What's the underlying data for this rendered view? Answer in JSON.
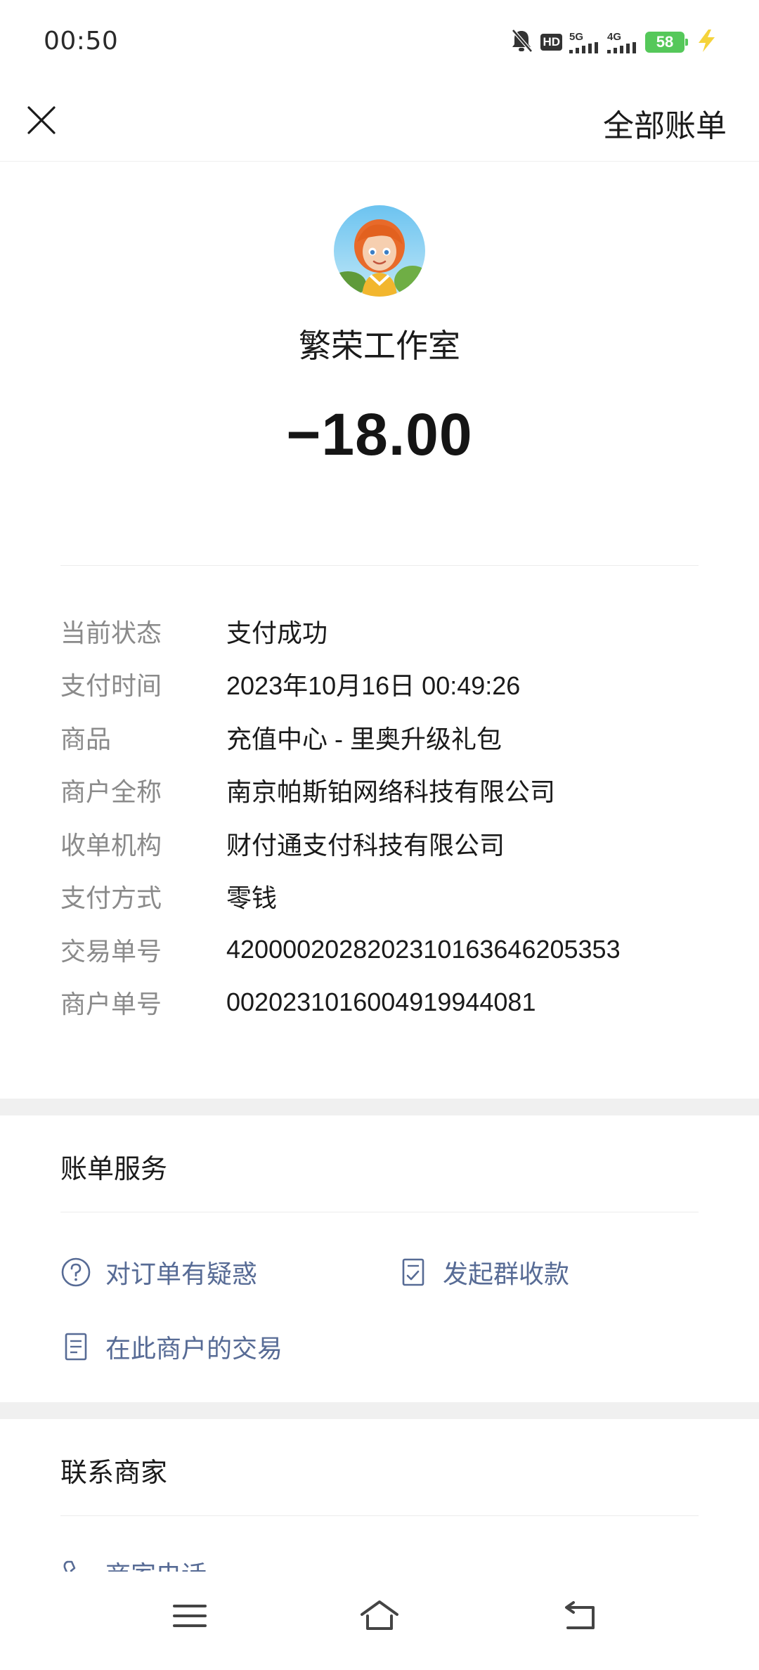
{
  "status_bar": {
    "time": "00:50",
    "battery": "58",
    "network_1": "5G",
    "network_2": "4G",
    "hd_label": "HD"
  },
  "top_bar": {
    "all_bills": "全部账单"
  },
  "merchant": {
    "name": "繁荣工作室",
    "amount": "−18.00"
  },
  "details": [
    {
      "label": "当前状态",
      "value": "支付成功"
    },
    {
      "label": "支付时间",
      "value": "2023年10月16日 00:49:26"
    },
    {
      "label": "商品",
      "value": "充值中心 - 里奥升级礼包"
    },
    {
      "label": "商户全称",
      "value": "南京帕斯铂网络科技有限公司"
    },
    {
      "label": "收单机构",
      "value": "财付通支付科技有限公司"
    },
    {
      "label": "支付方式",
      "value": "零钱"
    },
    {
      "label": "交易单号",
      "value": "4200002028202310163646205353"
    },
    {
      "label": "商户单号",
      "value": "0020231016004919944081"
    }
  ],
  "bill_services": {
    "title": "账单服务",
    "question_order": "对订单有疑惑",
    "group_collect": "发起群收款",
    "merchant_transactions": "在此商户的交易"
  },
  "contact": {
    "title": "联系商家",
    "merchant_phone": "商家电话"
  },
  "colors": {
    "link": "#576b95",
    "label_gray": "#8a8a8a",
    "battery_green": "#55c85a",
    "section_gap": "#f0f0f0"
  }
}
